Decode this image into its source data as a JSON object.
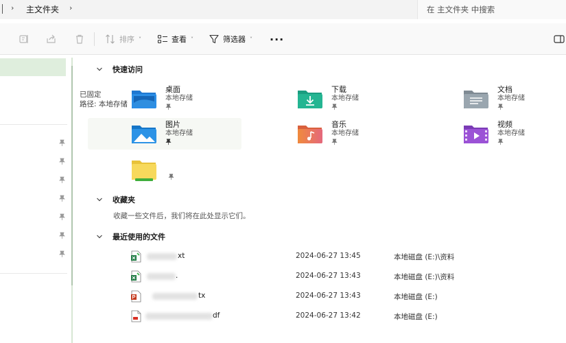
{
  "address": {
    "current_folder": "主文件夹",
    "separator": "›"
  },
  "search": {
    "placeholder": "在 主文件夹 中搜索"
  },
  "toolbar": {
    "sort_label": "排序",
    "view_label": "查看",
    "filter_label": "筛选器",
    "more_label": "···",
    "caret": "˅"
  },
  "sections": {
    "quick_access": "快速访问",
    "favorites": "收藏夹",
    "recent": "最近使用的文件"
  },
  "tooltip": {
    "line1": "已固定",
    "line2": "路径: 本地存储"
  },
  "quick_access": [
    {
      "name": "桌面",
      "sub": "本地存储",
      "icon": "desktop-folder-icon"
    },
    {
      "name": "下载",
      "sub": "本地存储",
      "icon": "downloads-folder-icon"
    },
    {
      "name": "文档",
      "sub": "本地存储",
      "icon": "documents-folder-icon"
    },
    {
      "name": "图片",
      "sub": "本地存储",
      "icon": "pictures-folder-icon"
    },
    {
      "name": "音乐",
      "sub": "本地存储",
      "icon": "music-folder-icon"
    },
    {
      "name": "视频",
      "sub": "本地存储",
      "icon": "videos-folder-icon"
    },
    {
      "name": "",
      "sub": "",
      "icon": "yellow-folder-icon"
    }
  ],
  "favorites_empty_text": "收藏一些文件后，我们将在此处显示它们。",
  "recent_files": [
    {
      "name_suffix": "xt",
      "date": "2024-06-27 13:45",
      "location": "本地磁盘 (E:)\\资料",
      "icon": "excel-file-icon"
    },
    {
      "name_suffix": ".",
      "date": "2024-06-27 13:43",
      "location": "本地磁盘 (E:)\\资料",
      "icon": "excel-file-icon"
    },
    {
      "name_suffix": "tx",
      "date": "2024-06-27 13:43",
      "location": "本地磁盘 (E:)",
      "icon": "powerpoint-file-icon"
    },
    {
      "name_suffix": "df",
      "date": "2024-06-27 13:42",
      "location": "本地磁盘 (E:)",
      "icon": "pdf-file-icon"
    }
  ],
  "colors": {
    "nav_selected": "#dfeedd",
    "accent": "#0067c0"
  }
}
